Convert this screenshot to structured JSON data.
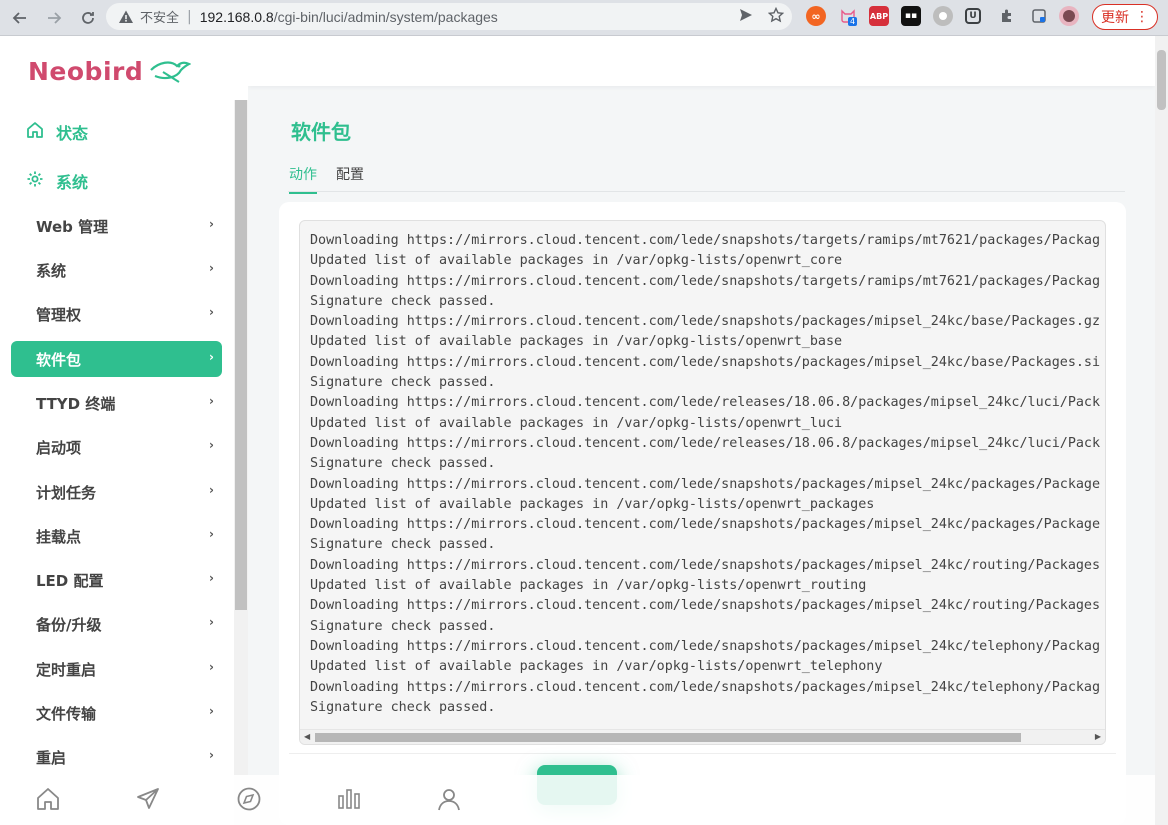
{
  "browser": {
    "security_text": "不安全",
    "url_host": "192.168.0.8",
    "url_path": "/cgi-bin/luci/admin/system/packages",
    "update_label": "更新",
    "extension_badge": "4"
  },
  "brand": {
    "logo_text": "Neobird"
  },
  "sidebar": {
    "top_items": [
      {
        "label": "状态",
        "icon": "home-icon"
      },
      {
        "label": "系统",
        "icon": "gear-icon"
      }
    ],
    "items": [
      {
        "label": "Web 管理"
      },
      {
        "label": "系统"
      },
      {
        "label": "管理权"
      },
      {
        "label": "软件包",
        "active": true
      },
      {
        "label": "TTYD 终端"
      },
      {
        "label": "启动项"
      },
      {
        "label": "计划任务"
      },
      {
        "label": "挂载点"
      },
      {
        "label": "LED 配置"
      },
      {
        "label": "备份/升级"
      },
      {
        "label": "定时重启"
      },
      {
        "label": "文件传输"
      },
      {
        "label": "重启"
      }
    ]
  },
  "main": {
    "title": "软件包",
    "tabs": [
      {
        "label": "动作",
        "active": true
      },
      {
        "label": "配置",
        "active": false
      }
    ],
    "log_lines": [
      "Downloading https://mirrors.cloud.tencent.com/lede/snapshots/targets/ramips/mt7621/packages/Packag",
      "Updated list of available packages in /var/opkg-lists/openwrt_core",
      "Downloading https://mirrors.cloud.tencent.com/lede/snapshots/targets/ramips/mt7621/packages/Packag",
      "Signature check passed.",
      "Downloading https://mirrors.cloud.tencent.com/lede/snapshots/packages/mipsel_24kc/base/Packages.gz",
      "Updated list of available packages in /var/opkg-lists/openwrt_base",
      "Downloading https://mirrors.cloud.tencent.com/lede/snapshots/packages/mipsel_24kc/base/Packages.si",
      "Signature check passed.",
      "Downloading https://mirrors.cloud.tencent.com/lede/releases/18.06.8/packages/mipsel_24kc/luci/Pack",
      "Updated list of available packages in /var/opkg-lists/openwrt_luci",
      "Downloading https://mirrors.cloud.tencent.com/lede/releases/18.06.8/packages/mipsel_24kc/luci/Pack",
      "Signature check passed.",
      "Downloading https://mirrors.cloud.tencent.com/lede/snapshots/packages/mipsel_24kc/packages/Package",
      "Updated list of available packages in /var/opkg-lists/openwrt_packages",
      "Downloading https://mirrors.cloud.tencent.com/lede/snapshots/packages/mipsel_24kc/packages/Package",
      "Signature check passed.",
      "Downloading https://mirrors.cloud.tencent.com/lede/snapshots/packages/mipsel_24kc/routing/Packages",
      "Updated list of available packages in /var/opkg-lists/openwrt_routing",
      "Downloading https://mirrors.cloud.tencent.com/lede/snapshots/packages/mipsel_24kc/routing/Packages",
      "Signature check passed.",
      "Downloading https://mirrors.cloud.tencent.com/lede/snapshots/packages/mipsel_24kc/telephony/Packag",
      "Updated list of available packages in /var/opkg-lists/openwrt_telephony",
      "Downloading https://mirrors.cloud.tencent.com/lede/snapshots/packages/mipsel_24kc/telephony/Packag",
      "Signature check passed."
    ]
  },
  "bottom_nav": [
    {
      "icon": "home-icon"
    },
    {
      "icon": "paper-plane-icon"
    },
    {
      "icon": "compass-icon"
    },
    {
      "icon": "bar-chart-icon"
    },
    {
      "icon": "user-icon"
    }
  ],
  "colors": {
    "accent": "#2fbf8f",
    "brand": "#d04a6e"
  }
}
